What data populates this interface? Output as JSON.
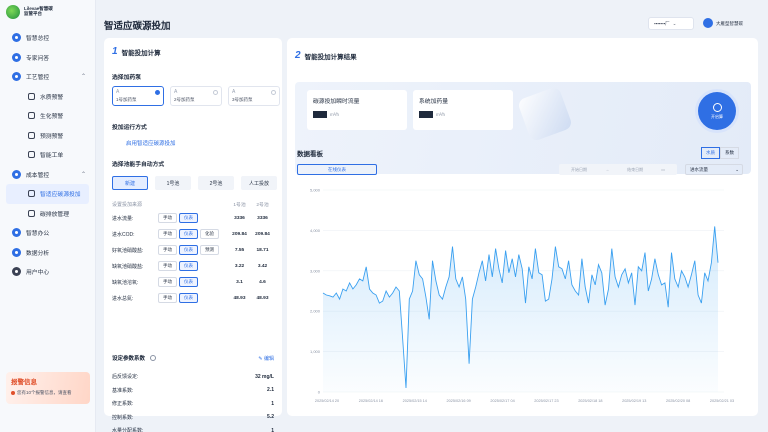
{
  "brand": {
    "line1": "Lilevae智慧碳",
    "line2": "监管平台"
  },
  "nav": [
    {
      "label": "智慧总控",
      "type": "item"
    },
    {
      "label": "专家问答",
      "type": "item"
    },
    {
      "label": "工艺管控",
      "type": "item",
      "expanded": true
    },
    {
      "label": "水质预警",
      "type": "sub"
    },
    {
      "label": "生化预警",
      "type": "sub"
    },
    {
      "label": "预测预警",
      "type": "sub"
    },
    {
      "label": "智能工单",
      "type": "sub"
    },
    {
      "label": "成本管控",
      "type": "item",
      "expanded": true
    },
    {
      "label": "智适应碳源投加",
      "type": "sub",
      "active": true
    },
    {
      "label": "碳排放管理",
      "type": "sub"
    },
    {
      "label": "智慧办公",
      "type": "item"
    },
    {
      "label": "数据分析",
      "type": "item"
    },
    {
      "label": "用户中心",
      "type": "item"
    }
  ],
  "alarm": {
    "title": "报警信息",
    "message": "您有10个报警信息，请查看"
  },
  "page_title": "智适应碳源投加",
  "header": {
    "select_label": "▪▪▪▪▪▪▪厂",
    "user_name": "大雁型智慧碳"
  },
  "left": {
    "section_num": "1",
    "section_title": "智能投加计算",
    "select_dose_label": "选择加药泵",
    "dose_cards": [
      {
        "title": "A",
        "name": "1号加药泵",
        "selected": true
      },
      {
        "title": "A",
        "name": "2号加药泵",
        "selected": false
      },
      {
        "title": "A",
        "name": "3号加药泵",
        "selected": false
      }
    ],
    "run_mode_label": "投加运行方式",
    "run_mode_link": "启用智适应碳源投加",
    "pool_mode_label": "选择池能手自动方式",
    "pool_tabs": [
      "新建",
      "1号池",
      "2号池",
      "人工投放"
    ],
    "table_head": {
      "name": "设置投加来源",
      "v1": "1号池",
      "v2": "2号池"
    },
    "rows": [
      {
        "name": "进水流量:",
        "buttons": [
          "手动",
          "仪表"
        ],
        "on": 1,
        "v1": "3336",
        "v2": "3336"
      },
      {
        "name": "进水COD:",
        "buttons": [
          "手动",
          "仪表",
          "化验"
        ],
        "on": 1,
        "v1": "209.84",
        "v2": "209.84"
      },
      {
        "name": "好氧池硝酸盐:",
        "buttons": [
          "手动",
          "仪表",
          "预测"
        ],
        "on": 1,
        "v1": "7.55",
        "v2": "18.71"
      },
      {
        "name": "缺氧池硝酸盐:",
        "buttons": [
          "手动",
          "仪表"
        ],
        "on": 1,
        "v1": "3.22",
        "v2": "3.42"
      },
      {
        "name": "缺氧池溶氧:",
        "buttons": [
          "手动",
          "仪表"
        ],
        "on": 1,
        "v1": "3.1",
        "v2": "4.6"
      },
      {
        "name": "进水总氮:",
        "buttons": [
          "手动",
          "仪表"
        ],
        "on": 1,
        "v1": "48.93",
        "v2": "48.93"
      }
    ],
    "params_title": "设定参数系数",
    "params_edit": "编辑",
    "params": [
      {
        "name": "后反馈设定:",
        "value": "32 mg/L"
      },
      {
        "name": "基准系数:",
        "value": "2.1"
      },
      {
        "name": "修正系数:",
        "value": "1"
      },
      {
        "name": "控制系数:",
        "value": "5.2"
      },
      {
        "name": "水量分配系数:",
        "value": "1"
      },
      {
        "name": "碳源当量:",
        "value": "0.9"
      }
    ]
  },
  "right": {
    "section_num": "2",
    "section_title": "智能投加计算结果",
    "kpi": [
      {
        "title": "碳源投加瞬时流量",
        "unit": "m³/h"
      },
      {
        "title": "系统加药量",
        "unit": "m³/h"
      }
    ],
    "run_button": "开启算",
    "board_title": "数据看板",
    "unit_tabs": [
      "水质",
      "系数"
    ],
    "ctrl_button": "在线仪表",
    "date_start": "开始日期",
    "date_sep": "→",
    "date_end": "结束日期",
    "metric_select": "进水流量",
    "icons": {
      "calendar": "calendar-icon",
      "chevron": "chevron-down-icon"
    }
  },
  "chart_data": {
    "type": "area",
    "y_ticks": [
      "5,000",
      "4,000",
      "3,000",
      "2,000",
      "1,000",
      "0"
    ],
    "ylim": [
      0,
      5000
    ],
    "x_labels": [
      "2025/02/14 20",
      "2025/02/14 16",
      "2025/02/15 14",
      "2025/02/16 09",
      "2025/02/17 04",
      "2025/02/17 23",
      "2025/02/18 18",
      "2025/02/19 13",
      "2025/02/20 08",
      "2025/02/21 03"
    ],
    "color": "#3aa0f0",
    "values": [
      2450,
      2400,
      2380,
      2350,
      2450,
      2300,
      2550,
      2500,
      2700,
      2550,
      2650,
      2800,
      2750,
      3100,
      2550,
      2450,
      2400,
      2200,
      2250,
      2500,
      2350,
      2450,
      2600,
      2500,
      1300,
      100,
      2300,
      2500,
      3250,
      2900,
      2800,
      2350,
      1800,
      3250,
      2750,
      2400,
      2300,
      2600,
      2850,
      3600,
      2800,
      2600,
      2850,
      2300,
      700,
      2300,
      2600,
      2950,
      3250,
      2750,
      3400,
      2850,
      3550,
      3050,
      2700,
      3500,
      2950,
      3300,
      2850,
      3400,
      3050,
      2200,
      3100,
      2800,
      3550,
      2950,
      2900,
      2250,
      2300,
      2800,
      3600,
      3100,
      3050,
      2800,
      3250,
      2650,
      2500,
      2400,
      3300,
      2600,
      2200,
      2900,
      2650,
      3150,
      2950,
      2150,
      2550,
      3550,
      2850,
      2600,
      2900,
      3050,
      2700,
      2950,
      2150,
      3100,
      3000,
      3450,
      2500,
      2800,
      3300,
      2900,
      2650,
      2700,
      2100,
      3450,
      2800,
      2600,
      3000,
      2850,
      2600,
      2900,
      3250,
      2400,
      2200,
      2950,
      2750,
      3200,
      4100,
      3200
    ]
  }
}
